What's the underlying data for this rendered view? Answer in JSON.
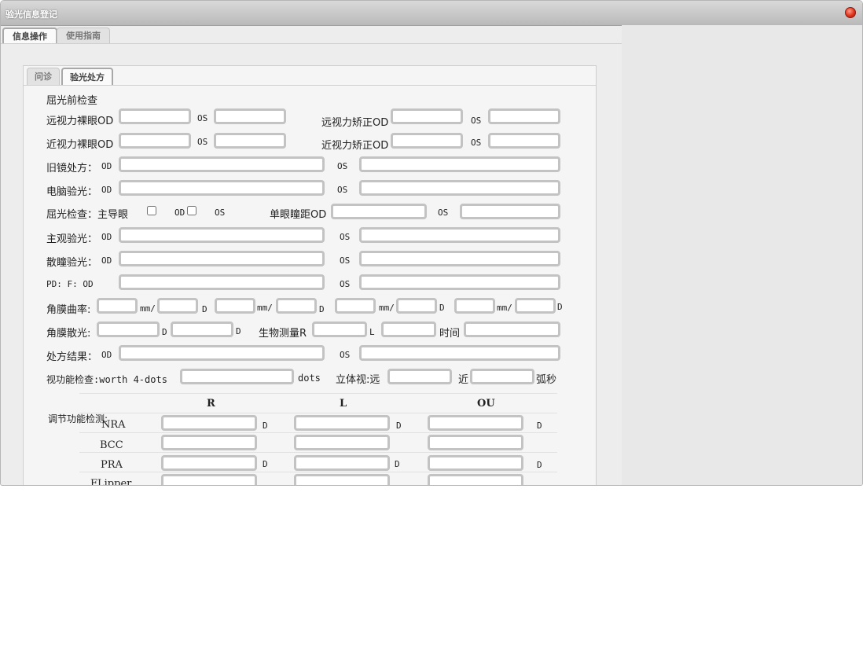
{
  "window": {
    "title": "验光信息登记"
  },
  "outer_tabs": [
    "信息操作",
    "使用指南"
  ],
  "inner_tabs": [
    "问诊",
    "验光处方"
  ],
  "labels": {
    "section": "屈光前检查",
    "far_naked": "远视力裸眼OD",
    "far_corrected": "远视力矫正OD",
    "near_naked": "近视力裸眼OD",
    "near_corrected": "近视力矫正OD",
    "old_rx": "旧镜处方：",
    "computer_rx": "电脑验光：",
    "refraction": "屈光检查：主导眼",
    "mono_pd": "单眼瞳距OD",
    "subjective": "主观验光：",
    "dilated": "散瞳验光：",
    "pd": "PD:  F:  OD",
    "curvature": "角膜曲率:",
    "astig": "角膜散光:",
    "biometry": "生物测量R",
    "time": "时间",
    "result": "处方结果：",
    "visual_function": "视功能检查:worth 4-dots",
    "stereo": "立体视:远",
    "near": "近",
    "arcsec": "弧秒",
    "accommodation": "调节功能检测:",
    "od": "OD",
    "os": "OS",
    "d": "D",
    "l": "L",
    "mm": "mm/",
    "dots": "dots"
  },
  "accommodation_table": {
    "columns": [
      "R",
      "L",
      "OU"
    ],
    "rows": [
      "NRA",
      "BCC",
      "PRA",
      "FLipper"
    ]
  }
}
